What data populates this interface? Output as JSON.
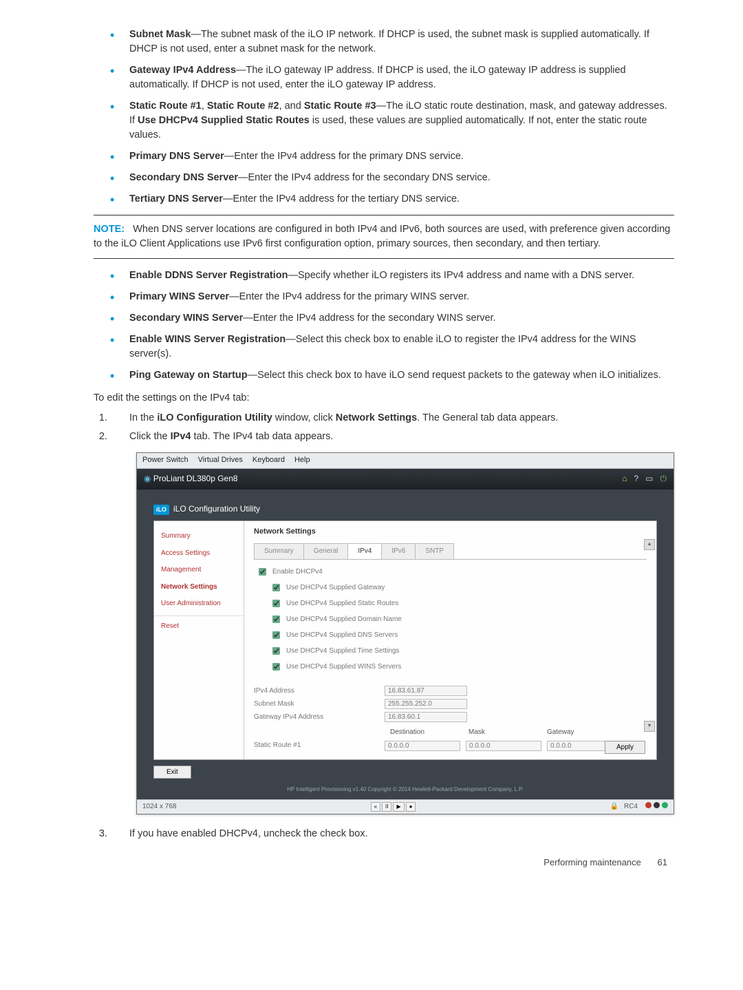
{
  "bullets1": [
    {
      "term": "Subnet Mask",
      "text": "—The subnet mask of the iLO IP network. If DHCP is used, the subnet mask is supplied automatically. If DHCP is not used, enter a subnet mask for the network."
    },
    {
      "term": "Gateway IPv4 Address",
      "text": "—The iLO gateway IP address. If DHCP is used, the iLO gateway IP address is supplied automatically. If DHCP is not used, enter the iLO gateway IP address."
    },
    {
      "term_html": "static_routes",
      "text": ""
    },
    {
      "term": "Primary DNS Server",
      "text": "—Enter the IPv4 address for the primary DNS service."
    },
    {
      "term": "Secondary DNS Server",
      "text": "—Enter the IPv4 address for the secondary DNS service."
    },
    {
      "term": "Tertiary DNS Server",
      "text": "—Enter the IPv4 address for the tertiary DNS service."
    }
  ],
  "static_routes": {
    "t1": "Static Route #1",
    "t2": "Static Route #2",
    "and": ", and ",
    "t3": "Static Route #3",
    "tail1": "—The iLO static route destination, mask, and gateway addresses. If ",
    "bold": "Use DHCPv4 Supplied Static Routes",
    "tail2": " is used, these values are supplied automatically. If not, enter the static route values."
  },
  "note": {
    "label": "NOTE:",
    "text": "When DNS server locations are configured in both IPv4 and IPv6, both sources are used, with preference given according to the iLO Client Applications use IPv6 first configuration option, primary sources, then secondary, and then tertiary."
  },
  "bullets2": [
    {
      "term": "Enable DDNS Server Registration",
      "text": "—Specify whether iLO registers its IPv4 address and name with a DNS server."
    },
    {
      "term": "Primary WINS Server",
      "text": "—Enter the IPv4 address for the primary WINS server."
    },
    {
      "term": "Secondary WINS Server",
      "text": "—Enter the IPv4 address for the secondary WINS server."
    },
    {
      "term": "Enable WINS Server Registration",
      "text": "—Select this check box to enable iLO to register the IPv4 address for the WINS server(s)."
    },
    {
      "term": "Ping Gateway on Startup",
      "text": "—Select this check box to have iLO send request packets to the gateway when iLO initializes."
    }
  ],
  "edit_intro": "To edit the settings on the IPv4 tab:",
  "steps12": {
    "s1_pre": "In the ",
    "s1_b1": "iLO Configuration Utility",
    "s1_mid": " window, click ",
    "s1_b2": "Network Settings",
    "s1_post": ". The General tab data appears.",
    "s2_pre": "Click the ",
    "s2_b": "IPv4",
    "s2_post": " tab. The IPv4 tab data appears."
  },
  "screenshot": {
    "menubar": [
      "Power Switch",
      "Virtual Drives",
      "Keyboard",
      "Help"
    ],
    "server": "ProLiant DL380p Gen8",
    "util_title": "iLO Configuration Utility",
    "nav": [
      "Summary",
      "Access Settings",
      "Management",
      "Network Settings",
      "User Administration",
      "Reset"
    ],
    "section": "Network Settings",
    "tabs": [
      "Summary",
      "General",
      "IPv4",
      "IPv6",
      "SNTP"
    ],
    "active_tab": 2,
    "enable": "Enable DHCPv4",
    "opts": [
      "Use DHCPv4 Supplied Gateway",
      "Use DHCPv4 Supplied Static Routes",
      "Use DHCPv4 Supplied Domain Name",
      "Use DHCPv4 Supplied DNS Servers",
      "Use DHCPv4 Supplied Time Settings",
      "Use DHCPv4 Supplied WINS Servers"
    ],
    "fields": {
      "ipv4_lbl": "IPv4 Address",
      "ipv4_val": "16.83.61.87",
      "mask_lbl": "Subnet Mask",
      "mask_val": "255.255.252.0",
      "gw_lbl": "Gateway IPv4 Address",
      "gw_val": "16.83.60.1"
    },
    "route_hdr": [
      "Destination",
      "Mask",
      "Gateway"
    ],
    "route": {
      "lbl": "Static Route #1",
      "d": "0.0.0.0",
      "m": "0.0.0.0",
      "g": "0.0.0.0"
    },
    "apply": "Apply",
    "exit": "Exit",
    "footer": "HP Intelligent Provisioning v1.40 Copyright © 2014 Hewlett-Packard Development Company, L.P.",
    "status_left": "1024 x 768",
    "status_rc": "RC4"
  },
  "step3": "If you have enabled DHCPv4, uncheck the check box.",
  "page_footer": {
    "label": "Performing maintenance",
    "num": "61"
  }
}
